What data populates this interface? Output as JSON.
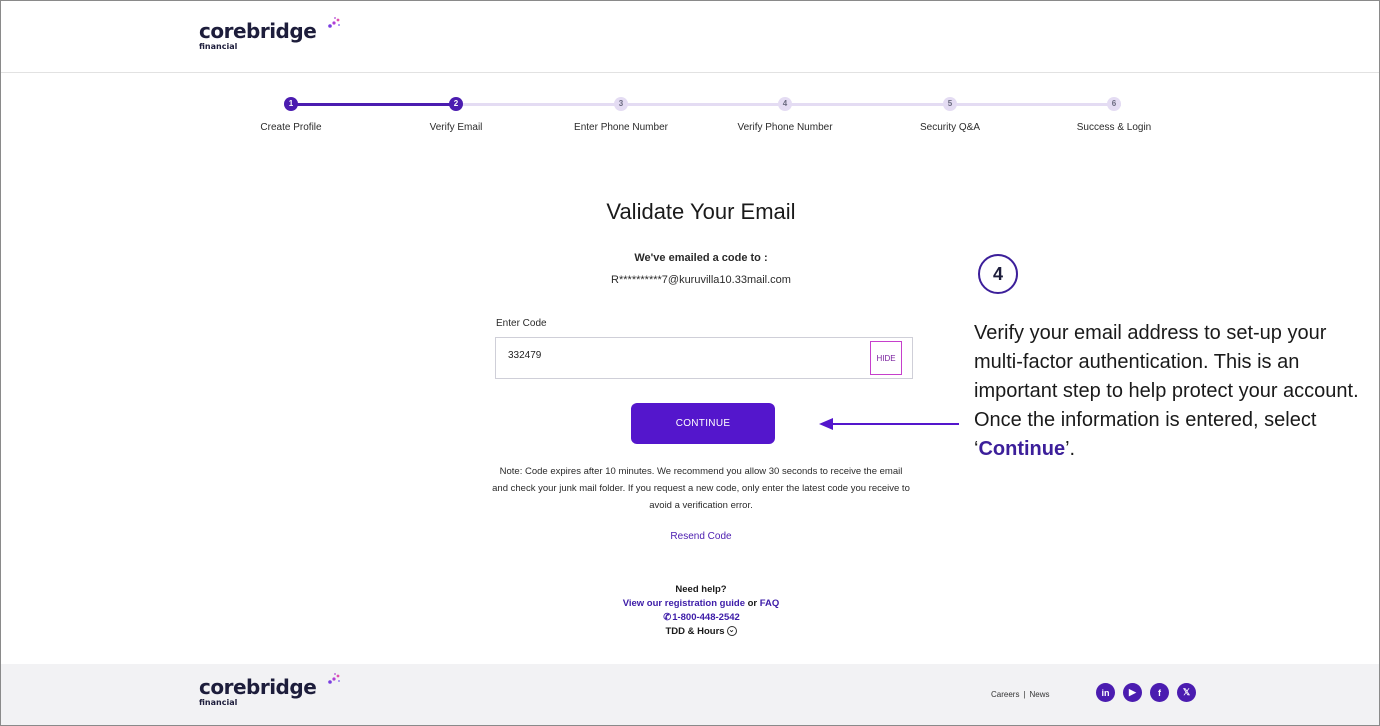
{
  "brand": {
    "name": "corebridge",
    "sub": "financial",
    "accent": "#5416cc",
    "dark": "#1d1d3b"
  },
  "stepper": {
    "steps": [
      {
        "number": "1",
        "label": "Create Profile",
        "state": "done"
      },
      {
        "number": "2",
        "label": "Verify Email",
        "state": "current"
      },
      {
        "number": "3",
        "label": "Enter Phone Number",
        "state": "todo"
      },
      {
        "number": "4",
        "label": "Verify Phone Number",
        "state": "todo"
      },
      {
        "number": "5",
        "label": "Security Q&A",
        "state": "todo"
      },
      {
        "number": "6",
        "label": "Success & Login",
        "state": "todo"
      }
    ]
  },
  "main": {
    "title": "Validate Your Email",
    "emailed_to": "We've emailed a code to :",
    "email": "R**********7@kuruvilla10.33mail.com",
    "code_label": "Enter Code",
    "code_value": "332479",
    "hide_label": "HIDE",
    "continue_label": "CONTINUE",
    "note": "Note: Code expires after 10 minutes. We recommend you allow 30 seconds to receive the email and check your junk mail folder. If you request a new code, only enter the latest code you receive to avoid a verification error.",
    "resend_label": "Resend Code"
  },
  "help": {
    "heading": "Need help?",
    "guide_link": "View our registration guide",
    "or": "or",
    "faq_link": "FAQ",
    "phone": "1-800-448-2542",
    "tdd": "TDD & Hours"
  },
  "callout": {
    "number": "4",
    "text_before": "Verify your email address to set-up your multi-factor authentication. This is an important step to help protect your account. Once the information is entered, select ‘",
    "bold": "Continue",
    "text_after": "’."
  },
  "footer": {
    "careers": "Careers",
    "separator": "|",
    "news": "News",
    "socials": [
      "linkedin-icon",
      "youtube-icon",
      "facebook-icon",
      "x-icon"
    ]
  }
}
